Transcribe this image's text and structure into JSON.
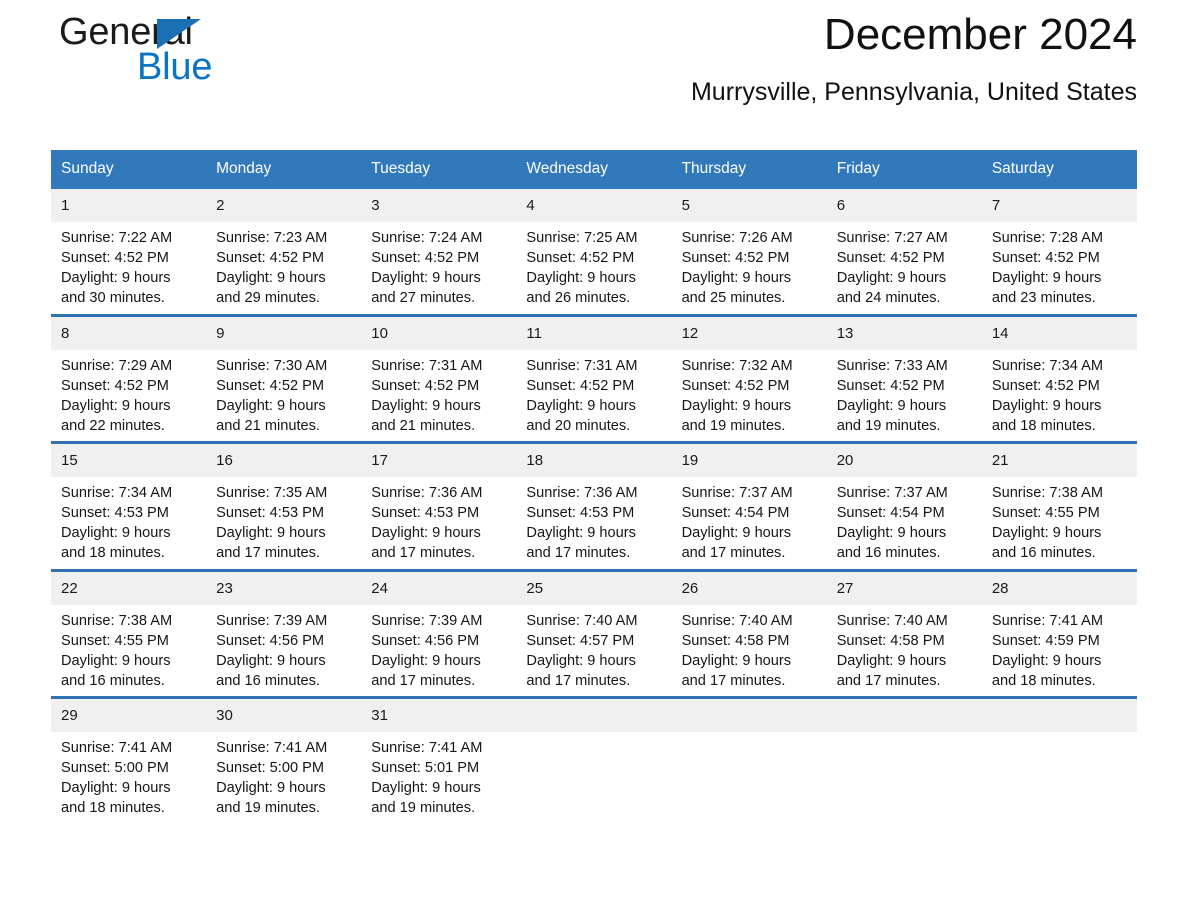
{
  "brand": {
    "name_part1": "General",
    "name_part2": "Blue",
    "flag_icon": "triangle-flag-icon",
    "accent_color": "#1b6fb5"
  },
  "header": {
    "title": "December 2024",
    "location": "Murrysville, Pennsylvania, United States"
  },
  "calendar": {
    "header_bg": "#3279bb",
    "separator_color": "#2e72b4",
    "daynum_bg": "#f0f0f0",
    "weekdays": [
      "Sunday",
      "Monday",
      "Tuesday",
      "Wednesday",
      "Thursday",
      "Friday",
      "Saturday"
    ],
    "weeks": [
      {
        "days": [
          {
            "date": "1",
            "sunrise": "Sunrise: 7:22 AM",
            "sunset": "Sunset: 4:52 PM",
            "daylight_line1": "Daylight: 9 hours",
            "daylight_line2": "and 30 minutes."
          },
          {
            "date": "2",
            "sunrise": "Sunrise: 7:23 AM",
            "sunset": "Sunset: 4:52 PM",
            "daylight_line1": "Daylight: 9 hours",
            "daylight_line2": "and 29 minutes."
          },
          {
            "date": "3",
            "sunrise": "Sunrise: 7:24 AM",
            "sunset": "Sunset: 4:52 PM",
            "daylight_line1": "Daylight: 9 hours",
            "daylight_line2": "and 27 minutes."
          },
          {
            "date": "4",
            "sunrise": "Sunrise: 7:25 AM",
            "sunset": "Sunset: 4:52 PM",
            "daylight_line1": "Daylight: 9 hours",
            "daylight_line2": "and 26 minutes."
          },
          {
            "date": "5",
            "sunrise": "Sunrise: 7:26 AM",
            "sunset": "Sunset: 4:52 PM",
            "daylight_line1": "Daylight: 9 hours",
            "daylight_line2": "and 25 minutes."
          },
          {
            "date": "6",
            "sunrise": "Sunrise: 7:27 AM",
            "sunset": "Sunset: 4:52 PM",
            "daylight_line1": "Daylight: 9 hours",
            "daylight_line2": "and 24 minutes."
          },
          {
            "date": "7",
            "sunrise": "Sunrise: 7:28 AM",
            "sunset": "Sunset: 4:52 PM",
            "daylight_line1": "Daylight: 9 hours",
            "daylight_line2": "and 23 minutes."
          }
        ]
      },
      {
        "days": [
          {
            "date": "8",
            "sunrise": "Sunrise: 7:29 AM",
            "sunset": "Sunset: 4:52 PM",
            "daylight_line1": "Daylight: 9 hours",
            "daylight_line2": "and 22 minutes."
          },
          {
            "date": "9",
            "sunrise": "Sunrise: 7:30 AM",
            "sunset": "Sunset: 4:52 PM",
            "daylight_line1": "Daylight: 9 hours",
            "daylight_line2": "and 21 minutes."
          },
          {
            "date": "10",
            "sunrise": "Sunrise: 7:31 AM",
            "sunset": "Sunset: 4:52 PM",
            "daylight_line1": "Daylight: 9 hours",
            "daylight_line2": "and 21 minutes."
          },
          {
            "date": "11",
            "sunrise": "Sunrise: 7:31 AM",
            "sunset": "Sunset: 4:52 PM",
            "daylight_line1": "Daylight: 9 hours",
            "daylight_line2": "and 20 minutes."
          },
          {
            "date": "12",
            "sunrise": "Sunrise: 7:32 AM",
            "sunset": "Sunset: 4:52 PM",
            "daylight_line1": "Daylight: 9 hours",
            "daylight_line2": "and 19 minutes."
          },
          {
            "date": "13",
            "sunrise": "Sunrise: 7:33 AM",
            "sunset": "Sunset: 4:52 PM",
            "daylight_line1": "Daylight: 9 hours",
            "daylight_line2": "and 19 minutes."
          },
          {
            "date": "14",
            "sunrise": "Sunrise: 7:34 AM",
            "sunset": "Sunset: 4:52 PM",
            "daylight_line1": "Daylight: 9 hours",
            "daylight_line2": "and 18 minutes."
          }
        ]
      },
      {
        "days": [
          {
            "date": "15",
            "sunrise": "Sunrise: 7:34 AM",
            "sunset": "Sunset: 4:53 PM",
            "daylight_line1": "Daylight: 9 hours",
            "daylight_line2": "and 18 minutes."
          },
          {
            "date": "16",
            "sunrise": "Sunrise: 7:35 AM",
            "sunset": "Sunset: 4:53 PM",
            "daylight_line1": "Daylight: 9 hours",
            "daylight_line2": "and 17 minutes."
          },
          {
            "date": "17",
            "sunrise": "Sunrise: 7:36 AM",
            "sunset": "Sunset: 4:53 PM",
            "daylight_line1": "Daylight: 9 hours",
            "daylight_line2": "and 17 minutes."
          },
          {
            "date": "18",
            "sunrise": "Sunrise: 7:36 AM",
            "sunset": "Sunset: 4:53 PM",
            "daylight_line1": "Daylight: 9 hours",
            "daylight_line2": "and 17 minutes."
          },
          {
            "date": "19",
            "sunrise": "Sunrise: 7:37 AM",
            "sunset": "Sunset: 4:54 PM",
            "daylight_line1": "Daylight: 9 hours",
            "daylight_line2": "and 17 minutes."
          },
          {
            "date": "20",
            "sunrise": "Sunrise: 7:37 AM",
            "sunset": "Sunset: 4:54 PM",
            "daylight_line1": "Daylight: 9 hours",
            "daylight_line2": "and 16 minutes."
          },
          {
            "date": "21",
            "sunrise": "Sunrise: 7:38 AM",
            "sunset": "Sunset: 4:55 PM",
            "daylight_line1": "Daylight: 9 hours",
            "daylight_line2": "and 16 minutes."
          }
        ]
      },
      {
        "days": [
          {
            "date": "22",
            "sunrise": "Sunrise: 7:38 AM",
            "sunset": "Sunset: 4:55 PM",
            "daylight_line1": "Daylight: 9 hours",
            "daylight_line2": "and 16 minutes."
          },
          {
            "date": "23",
            "sunrise": "Sunrise: 7:39 AM",
            "sunset": "Sunset: 4:56 PM",
            "daylight_line1": "Daylight: 9 hours",
            "daylight_line2": "and 16 minutes."
          },
          {
            "date": "24",
            "sunrise": "Sunrise: 7:39 AM",
            "sunset": "Sunset: 4:56 PM",
            "daylight_line1": "Daylight: 9 hours",
            "daylight_line2": "and 17 minutes."
          },
          {
            "date": "25",
            "sunrise": "Sunrise: 7:40 AM",
            "sunset": "Sunset: 4:57 PM",
            "daylight_line1": "Daylight: 9 hours",
            "daylight_line2": "and 17 minutes."
          },
          {
            "date": "26",
            "sunrise": "Sunrise: 7:40 AM",
            "sunset": "Sunset: 4:58 PM",
            "daylight_line1": "Daylight: 9 hours",
            "daylight_line2": "and 17 minutes."
          },
          {
            "date": "27",
            "sunrise": "Sunrise: 7:40 AM",
            "sunset": "Sunset: 4:58 PM",
            "daylight_line1": "Daylight: 9 hours",
            "daylight_line2": "and 17 minutes."
          },
          {
            "date": "28",
            "sunrise": "Sunrise: 7:41 AM",
            "sunset": "Sunset: 4:59 PM",
            "daylight_line1": "Daylight: 9 hours",
            "daylight_line2": "and 18 minutes."
          }
        ]
      },
      {
        "days": [
          {
            "date": "29",
            "sunrise": "Sunrise: 7:41 AM",
            "sunset": "Sunset: 5:00 PM",
            "daylight_line1": "Daylight: 9 hours",
            "daylight_line2": "and 18 minutes."
          },
          {
            "date": "30",
            "sunrise": "Sunrise: 7:41 AM",
            "sunset": "Sunset: 5:00 PM",
            "daylight_line1": "Daylight: 9 hours",
            "daylight_line2": "and 19 minutes."
          },
          {
            "date": "31",
            "sunrise": "Sunrise: 7:41 AM",
            "sunset": "Sunset: 5:01 PM",
            "daylight_line1": "Daylight: 9 hours",
            "daylight_line2": "and 19 minutes."
          },
          {
            "date": "",
            "sunrise": "",
            "sunset": "",
            "daylight_line1": "",
            "daylight_line2": ""
          },
          {
            "date": "",
            "sunrise": "",
            "sunset": "",
            "daylight_line1": "",
            "daylight_line2": ""
          },
          {
            "date": "",
            "sunrise": "",
            "sunset": "",
            "daylight_line1": "",
            "daylight_line2": ""
          },
          {
            "date": "",
            "sunrise": "",
            "sunset": "",
            "daylight_line1": "",
            "daylight_line2": ""
          }
        ]
      }
    ]
  }
}
